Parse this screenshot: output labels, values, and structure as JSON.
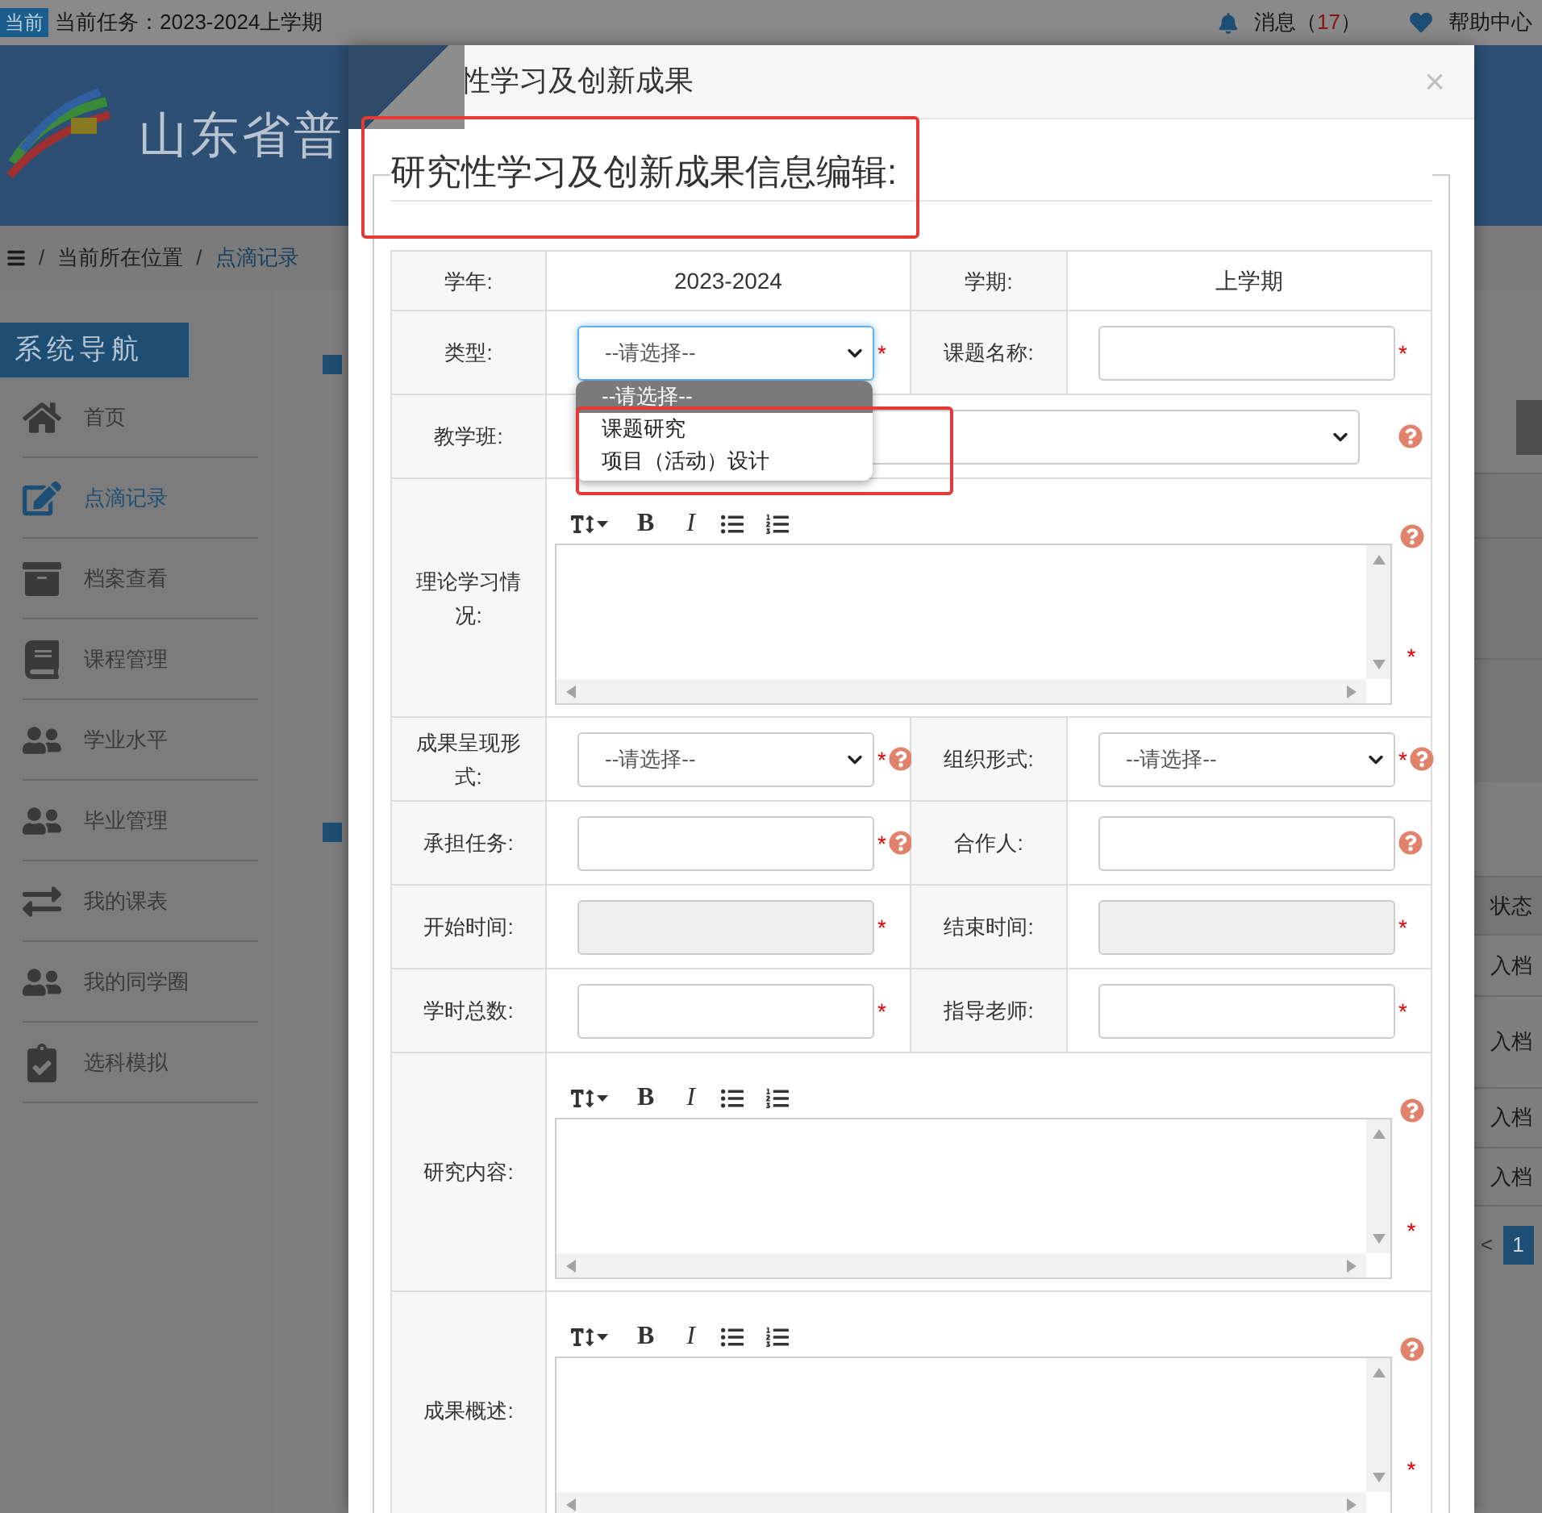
{
  "top_bar": {
    "badge": "当前",
    "task": "当前任务：2023-2024上学期",
    "messages_label": "消息（",
    "messages_count": "17",
    "messages_end": "）",
    "help": "帮助中心"
  },
  "banner": {
    "title": "山东省普"
  },
  "breadcrumb": [
    {
      "separator": "/",
      "label": "当前所在位置",
      "selected": false
    },
    {
      "separator": "/",
      "label": "点滴记录",
      "selected": true
    }
  ],
  "sidebar": {
    "title": "系统导航",
    "items": [
      {
        "label": "首页",
        "selected": false
      },
      {
        "label": "点滴记录",
        "selected": true
      },
      {
        "label": "档案查看",
        "selected": false
      },
      {
        "label": "课程管理",
        "selected": false
      },
      {
        "label": "学业水平",
        "selected": false
      },
      {
        "label": "毕业管理",
        "selected": false
      },
      {
        "label": "我的课表",
        "selected": false
      },
      {
        "label": "我的同学圈",
        "selected": false
      },
      {
        "label": "选科模拟",
        "selected": false
      }
    ]
  },
  "background_table": {
    "header": "状态",
    "cells": [
      "入档",
      "入档",
      "入档",
      "入档"
    ]
  },
  "pagination": {
    "prev": "<",
    "pages": [
      {
        "label": "1",
        "selected": true
      }
    ]
  },
  "modal": {
    "title": "性学习及创新成果",
    "close": "×",
    "legend": "研究性学习及创新成果信息编辑:",
    "rows": [
      {
        "cells": [
          {
            "label": "学年:",
            "field": {
              "kind": "text",
              "value": "2023-2024"
            }
          },
          {
            "label": "学期:",
            "field": {
              "kind": "text",
              "value": "上学期"
            }
          }
        ]
      },
      {
        "cells": [
          {
            "label": "类型:",
            "field": {
              "kind": "select",
              "value": "--请选择--",
              "focused": true,
              "mark": "*"
            }
          },
          {
            "label": "课题名称:",
            "field": {
              "kind": "input",
              "disabled": false,
              "mark": "*"
            }
          }
        ]
      },
      {
        "cells": [
          {
            "label": "教学班:",
            "field": {
              "kind": "select",
              "focused": false,
              "help": true
            }
          }
        ]
      },
      {
        "cells": [
          {
            "label": "理论学习情况:",
            "field": {
              "kind": "editor",
              "bold": "B",
              "italic": "I",
              "mark": "*",
              "help": true
            }
          }
        ]
      },
      {
        "cells": [
          {
            "label": "成果呈现形式:",
            "field": {
              "kind": "select",
              "value": "--请选择--",
              "focused": false,
              "mark": "*",
              "help": true
            }
          },
          {
            "label": "组织形式:",
            "field": {
              "kind": "select",
              "value": "--请选择--",
              "focused": false,
              "mark": "*",
              "help": true
            }
          }
        ]
      },
      {
        "cells": [
          {
            "label": "承担任务:",
            "field": {
              "kind": "input",
              "disabled": false,
              "mark": "*",
              "help": true
            }
          },
          {
            "label": "合作人:",
            "field": {
              "kind": "input",
              "disabled": false,
              "help": true
            }
          }
        ]
      },
      {
        "cells": [
          {
            "label": "开始时间:",
            "field": {
              "kind": "input",
              "disabled": true,
              "mark": "*"
            }
          },
          {
            "label": "结束时间:",
            "field": {
              "kind": "input",
              "disabled": true,
              "mark": "*"
            }
          }
        ]
      },
      {
        "cells": [
          {
            "label": "学时总数:",
            "field": {
              "kind": "input",
              "disabled": false,
              "mark": "*"
            }
          },
          {
            "label": "指导老师:",
            "field": {
              "kind": "input",
              "disabled": false,
              "mark": "*"
            }
          }
        ]
      },
      {
        "cells": [
          {
            "label": "研究内容:",
            "field": {
              "kind": "editor",
              "bold": "B",
              "italic": "I",
              "mark": "*",
              "help": true
            }
          }
        ]
      },
      {
        "cells": [
          {
            "label": "成果概述:",
            "field": {
              "kind": "editor",
              "bold": "B",
              "italic": "I",
              "mark": "*",
              "help": true
            }
          }
        ]
      }
    ]
  },
  "dropdown": {
    "options": [
      {
        "label": "--请选择--",
        "selected": true
      },
      {
        "label": "课题研究",
        "selected": false
      },
      {
        "label": "项目（活动）设计",
        "selected": false
      }
    ]
  }
}
